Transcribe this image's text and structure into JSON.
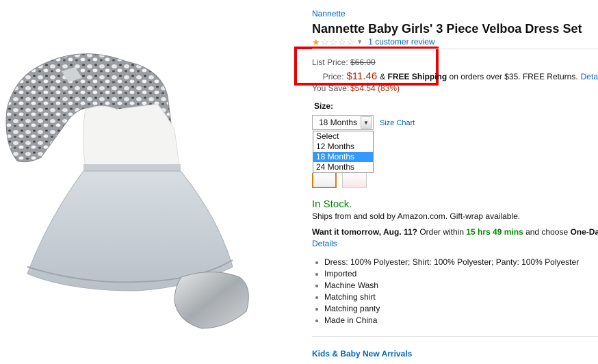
{
  "product": {
    "brand": "Nannette",
    "title": "Nannette Baby Girls' 3 Piece Velboa Dress Set",
    "rating_stars": 1,
    "rating_max": 5,
    "review_link": "1 customer review"
  },
  "pricing": {
    "list_label": "List Price:",
    "list_value": "$66.00",
    "price_label": "Price:",
    "price_value": "$11.46",
    "shipping_prefix": "& ",
    "shipping_bold": "FREE Shipping",
    "shipping_suffix": " on orders over $35. FREE Returns.",
    "details_link": "Deta",
    "save_label": "You Save:",
    "save_value": "$54.54 (83%)"
  },
  "size": {
    "label": "Size:",
    "selected": "18 Months",
    "chart_link": "Size Chart",
    "options": [
      "Select",
      "12 Months",
      "18 Months",
      "24 Months"
    ],
    "highlighted_option": "18 Months"
  },
  "availability": {
    "status": "In Stock.",
    "ships_from": "Ships from and sold by Amazon.com. Gift-wrap available.",
    "want_prefix": "Want it tomorrow, Aug. 11?",
    "order_within": " Order within ",
    "countdown": "15 hrs 49 mins",
    "choose": " and choose ",
    "choose_option": "One-Da",
    "details_link": "Details"
  },
  "features": [
    "Dress: 100% Polyester; Shirt: 100% Polyester; Panty: 100% Polyester",
    "Imported",
    "Machine Wash",
    "Matching shirt",
    "Matching panty",
    "Made in China"
  ],
  "footer": {
    "kids_link": "Kids & Baby New Arrivals"
  },
  "colors": {
    "link": "#0066c0",
    "price": "#b12704",
    "in_stock": "#008a00",
    "highlight_box": "#e00000",
    "selected_option": "#3399ff"
  },
  "icons": {
    "star_full": "star-full-icon",
    "star_empty": "star-empty-icon",
    "dropdown_arrow": "chevron-down-icon"
  }
}
